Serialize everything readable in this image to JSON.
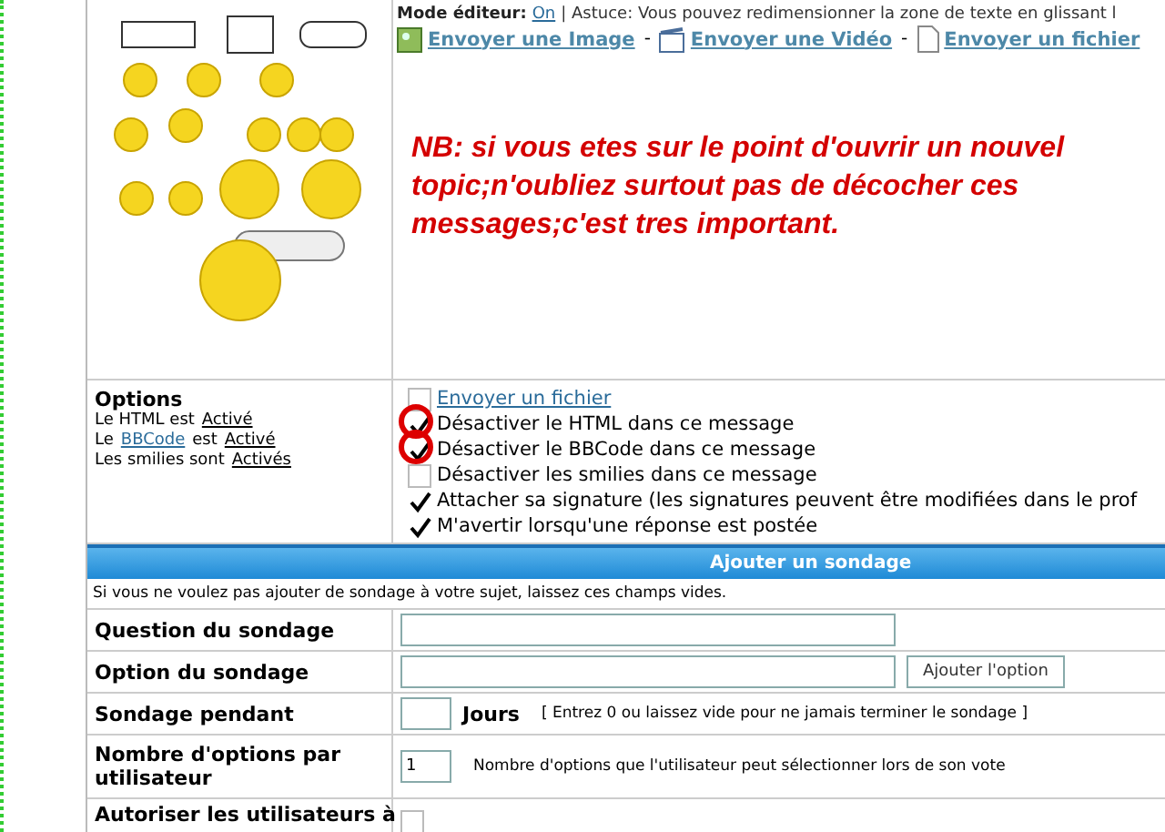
{
  "editor": {
    "mode_label": "Mode éditeur:",
    "mode_value": "On",
    "tip": "| Astuce: Vous pouvez redimensionner la zone de texte en glissant l"
  },
  "attachments": [
    {
      "kind": "image",
      "label": "Envoyer une Image"
    },
    {
      "kind": "video",
      "label": "Envoyer une Vidéo"
    },
    {
      "kind": "file",
      "label": "Envoyer un fichier"
    }
  ],
  "separator": "-",
  "notice": "NB: si vous etes sur le point d'ouvrir un nouvel topic;n'oubliez surtout pas de décocher ces messages;c'est tres important.",
  "options": {
    "title": "Options",
    "status": [
      [
        {
          "text": "Le HTML est",
          "kind": "plain"
        },
        {
          "text": "Activé",
          "kind": "underline"
        }
      ],
      [
        {
          "text": "Le",
          "kind": "plain"
        },
        {
          "text": "BBCode",
          "kind": "link"
        },
        {
          "text": "est",
          "kind": "plain"
        },
        {
          "text": "Activé",
          "kind": "underline"
        }
      ],
      [
        {
          "text": "Les smilies sont",
          "kind": "plain"
        },
        {
          "text": "Activés",
          "kind": "underline"
        }
      ]
    ],
    "checkboxes": [
      {
        "label": "Envoyer un fichier",
        "kind": "link",
        "checked": false,
        "circled": false
      },
      {
        "label": "Désactiver le HTML dans ce message",
        "kind": "plain",
        "checked": true,
        "circled": true
      },
      {
        "label": "Désactiver le BBCode dans ce message",
        "kind": "plain",
        "checked": true,
        "circled": true
      },
      {
        "label": "Désactiver les smilies dans ce message",
        "kind": "plain",
        "checked": false,
        "circled": false
      },
      {
        "label": "Attacher sa signature (les signatures peuvent être modifiées dans le prof",
        "kind": "plain",
        "checked": true,
        "circled": false
      },
      {
        "label": "M'avertir lorsqu'une réponse est postée",
        "kind": "plain",
        "checked": true,
        "circled": false
      }
    ]
  },
  "poll": {
    "title": "Ajouter un sondage",
    "hint": "Si vous ne voulez pas ajouter de sondage à votre sujet, laissez ces champs vides.",
    "rows": [
      {
        "kind": "text",
        "label": "Question du sondage"
      },
      {
        "kind": "text_button",
        "label": "Option du sondage",
        "button": "Ajouter l'option"
      },
      {
        "kind": "days",
        "label": "Sondage pendant",
        "unit": "Jours",
        "note": "[ Entrez 0 ou laissez vide pour ne jamais terminer le sondage ]"
      },
      {
        "kind": "number",
        "label": "Nombre d'options par utilisateur",
        "value": "1",
        "note": "Nombre d'options que l'utilisateur peut sélectionner lors de son vote"
      },
      {
        "kind": "checkbox",
        "label": "Autoriser les utilisateurs à",
        "checked": false
      }
    ]
  }
}
